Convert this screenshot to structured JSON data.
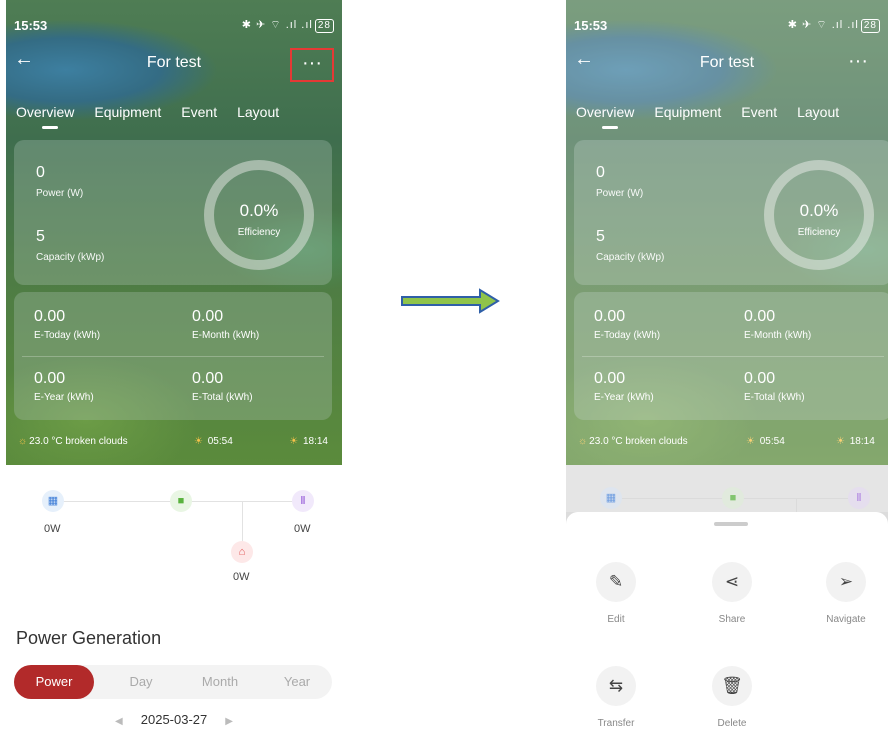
{
  "statusbar": {
    "time": "15:53",
    "icons": "✱ ✈ ⌔ .ıl .ıl",
    "battery": "28"
  },
  "topbar": {
    "title": "For test"
  },
  "tabs": [
    "Overview",
    "Equipment",
    "Event",
    "Layout"
  ],
  "overview": {
    "power_value": "0",
    "power_label": "Power (W)",
    "capacity_value": "5",
    "capacity_label": "Capacity (kWp)",
    "efficiency_value": "0.0%",
    "efficiency_label": "Efficiency"
  },
  "energy": {
    "today_value": "0.00",
    "today_label": "E-Today (kWh)",
    "month_value": "0.00",
    "month_label": "E-Month (kWh)",
    "year_value": "0.00",
    "year_label": "E-Year (kWh)",
    "total_value": "0.00",
    "total_label": "E-Total (kWh)"
  },
  "weather": {
    "temp_desc": "23.0 °C broken clouds",
    "sunrise": "05:54",
    "sunset": "18:14"
  },
  "flow": {
    "pv": "0W",
    "grid": "0W",
    "home": "0W"
  },
  "power_generation": {
    "title": "Power Generation",
    "segments": [
      "Power",
      "Day",
      "Month",
      "Year"
    ],
    "date": "2025-03-27"
  },
  "sheet": {
    "actions": [
      {
        "label": "Edit",
        "icon": "edit-icon"
      },
      {
        "label": "Share",
        "icon": "share-icon"
      },
      {
        "label": "Navigate",
        "icon": "navigate-icon"
      },
      {
        "label": "Transfer",
        "icon": "transfer-icon"
      },
      {
        "label": "Delete",
        "icon": "delete-icon"
      }
    ]
  },
  "colors": {
    "accent": "#b22a2a",
    "highlight": "#e53935",
    "arrow_fill": "#8fc44a",
    "arrow_stroke": "#2f5fa8"
  }
}
